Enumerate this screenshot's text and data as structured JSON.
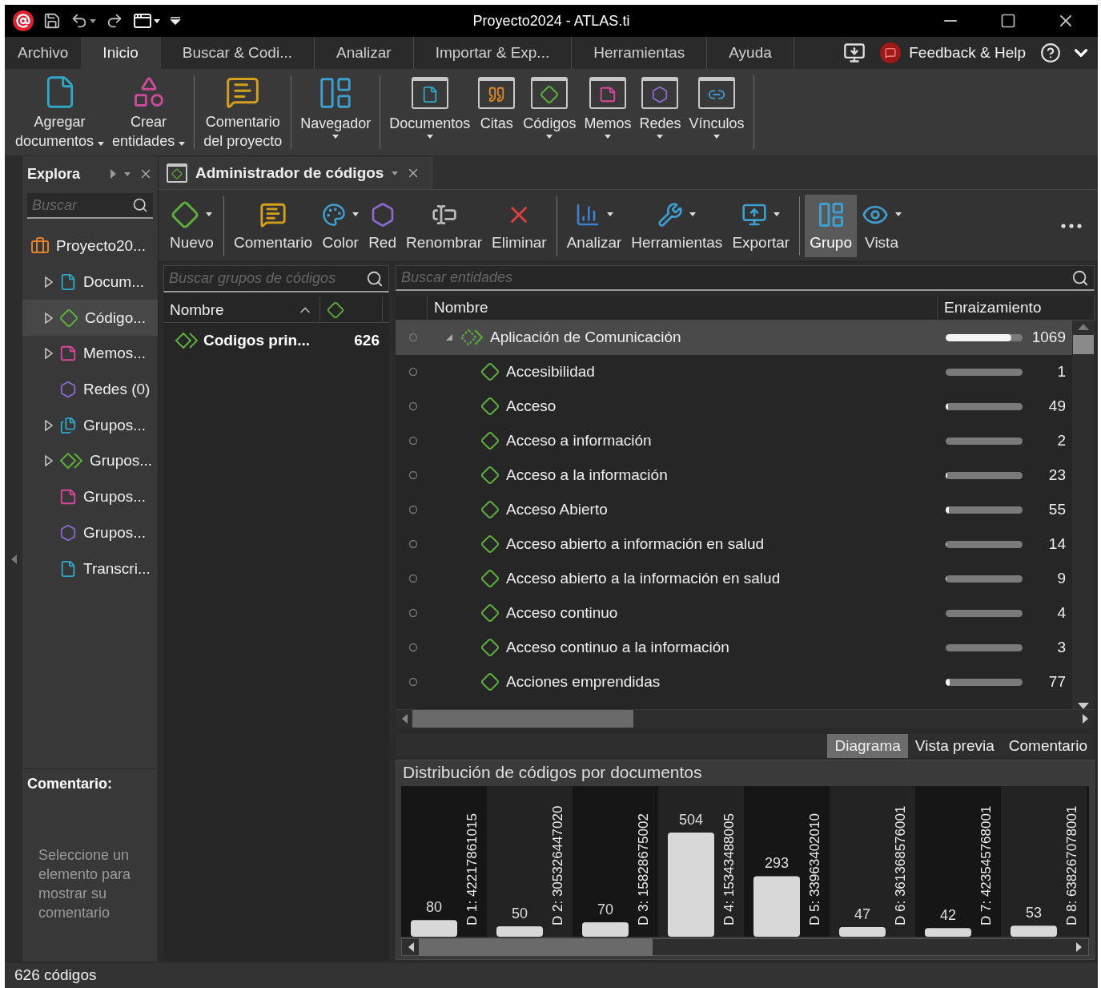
{
  "window": {
    "title": "Proyecto2024 - ATLAS.ti"
  },
  "menu_tabs": [
    {
      "label": "Archivo",
      "selected": false
    },
    {
      "label": "Inicio",
      "selected": true
    },
    {
      "label": "Buscar & Codi...",
      "selected": false
    },
    {
      "label": "Analizar",
      "selected": false
    },
    {
      "label": "Importar & Exp...",
      "selected": false
    },
    {
      "label": "Herramientas",
      "selected": false
    },
    {
      "label": "Ayuda",
      "selected": false
    }
  ],
  "feedback": {
    "label": "Feedback & Help"
  },
  "ribbon": [
    {
      "kind": "add-document",
      "label": "Agregar\ndocumentos",
      "dropdown": true,
      "separator_after": false
    },
    {
      "kind": "create",
      "label": "Crear\nentidades",
      "dropdown": true,
      "separator_after": true
    },
    {
      "kind": "comment",
      "label": "Comentario\ndel proyecto",
      "dropdown": false,
      "separator_after": true
    },
    {
      "kind": "navigator",
      "label": "Navegador",
      "dropdown": true,
      "separator_after": true
    },
    {
      "kind": "documents",
      "label": "Documentos",
      "dropdown": true,
      "separator_after": false
    },
    {
      "kind": "quotes",
      "label": "Citas",
      "dropdown": false,
      "separator_after": false
    },
    {
      "kind": "codes",
      "label": "Códigos",
      "dropdown": true,
      "separator_after": false
    },
    {
      "kind": "memos",
      "label": "Memos",
      "dropdown": true,
      "separator_after": false
    },
    {
      "kind": "networks",
      "label": "Redes",
      "dropdown": true,
      "separator_after": false
    },
    {
      "kind": "links",
      "label": "Vínculos",
      "dropdown": true,
      "separator_after": true
    }
  ],
  "explorer": {
    "title": "Explora",
    "search_placeholder": "Buscar",
    "tree": [
      {
        "kind": "project",
        "label": "Proyecto20...",
        "selected": false,
        "expandable": false,
        "children": [
          {
            "kind": "document",
            "label": "Docum...",
            "selected": false,
            "expandable": true
          },
          {
            "kind": "code",
            "label": "Código...",
            "selected": true,
            "expandable": true
          },
          {
            "kind": "memo",
            "label": "Memos...",
            "selected": false,
            "expandable": true
          },
          {
            "kind": "network",
            "label": "Redes (0)",
            "selected": false,
            "expandable": false
          },
          {
            "kind": "document-group",
            "label": "Grupos...",
            "selected": false,
            "expandable": true
          },
          {
            "kind": "code-group",
            "label": "Grupos...",
            "selected": false,
            "expandable": true
          },
          {
            "kind": "memo-group",
            "label": "Grupos...",
            "selected": false,
            "expandable": false
          },
          {
            "kind": "network-group",
            "label": "Grupos...",
            "selected": false,
            "expandable": false
          },
          {
            "kind": "document",
            "label": "Transcri...",
            "selected": false,
            "expandable": false
          }
        ]
      }
    ]
  },
  "comment_panel": {
    "title": "Comentario:",
    "text": "Seleccione un elemento para mostrar su comentario"
  },
  "manager": {
    "tab": "Administrador de códigos",
    "toolbar": [
      {
        "kind": "new",
        "label": "Nuevo",
        "dropdown": true,
        "selected": false,
        "separator_after": true
      },
      {
        "kind": "comment",
        "label": "Comentario",
        "dropdown": false,
        "selected": false,
        "separator_after": false
      },
      {
        "kind": "color",
        "label": "Color",
        "dropdown": true,
        "selected": false,
        "separator_after": false
      },
      {
        "kind": "network",
        "label": "Red",
        "dropdown": false,
        "selected": false,
        "separator_after": false
      },
      {
        "kind": "rename",
        "label": "Renombrar",
        "dropdown": false,
        "selected": false,
        "separator_after": false
      },
      {
        "kind": "delete",
        "label": "Eliminar",
        "dropdown": false,
        "selected": false,
        "separator_after": true
      },
      {
        "kind": "analyze",
        "label": "Analizar",
        "dropdown": true,
        "selected": false,
        "separator_after": false
      },
      {
        "kind": "tools",
        "label": "Herramientas",
        "dropdown": true,
        "selected": false,
        "separator_after": false
      },
      {
        "kind": "export",
        "label": "Exportar",
        "dropdown": true,
        "selected": false,
        "separator_after": true
      },
      {
        "kind": "group",
        "label": "Grupo",
        "dropdown": false,
        "selected": true,
        "separator_after": false
      },
      {
        "kind": "view",
        "label": "Vista",
        "dropdown": true,
        "selected": false,
        "separator_after": false
      },
      {
        "kind": "more"
      }
    ],
    "groups_pane": {
      "search_placeholder": "Buscar grupos de códigos",
      "columns": [
        "Nombre"
      ],
      "rows": [
        {
          "label": "Codigos prin...",
          "count": "626"
        }
      ]
    },
    "codes_pane": {
      "search_placeholder": "Buscar entidades",
      "columns": [
        "Nombre",
        "Enraizamiento"
      ],
      "rows": [
        {
          "kind": "group",
          "name": "Aplicación de Comunicación",
          "count": "1069",
          "level": 0.85,
          "selected": true,
          "expanded": true,
          "children": [
            {
              "kind": "code",
              "name": "Accesibilidad",
              "count": "1",
              "level": 0,
              "selected": false
            },
            {
              "kind": "code",
              "name": "Acceso",
              "count": "49",
              "level": 0.03,
              "selected": false
            },
            {
              "kind": "code",
              "name": "Acceso a información",
              "count": "2",
              "level": 0,
              "selected": false
            },
            {
              "kind": "code",
              "name": "Acceso a la información",
              "count": "23",
              "level": 0.02,
              "selected": false
            },
            {
              "kind": "code",
              "name": "Acceso Abierto",
              "count": "55",
              "level": 0.04,
              "selected": false
            },
            {
              "kind": "code",
              "name": "Acceso abierto a información en salud",
              "count": "14",
              "level": 0.01,
              "selected": false
            },
            {
              "kind": "code",
              "name": "Acceso abierto a la información en salud",
              "count": "9",
              "level": 0.01,
              "selected": false
            },
            {
              "kind": "code",
              "name": "Acceso continuo",
              "count": "4",
              "level": 0,
              "selected": false
            },
            {
              "kind": "code",
              "name": "Acceso continuo a la información",
              "count": "3",
              "level": 0,
              "selected": false
            },
            {
              "kind": "code",
              "name": "Acciones emprendidas",
              "count": "77",
              "level": 0.05,
              "selected": false
            }
          ]
        }
      ]
    },
    "preview_tabs": [
      {
        "label": "Diagrama",
        "selected": true
      },
      {
        "label": "Vista previa",
        "selected": false
      },
      {
        "label": "Comentario",
        "selected": false
      }
    ],
    "chart_data": {
      "type": "bar",
      "title": "Distribución de códigos por documentos",
      "categories": [
        "D 1: 42217861015",
        "D 2: 305326447020",
        "D 3: 15828675002",
        "D 4: 15343488005",
        "D 5: 33963402010",
        "D 6: 361368576001",
        "D 7: 423545768001",
        "D 8: 638267078001"
      ],
      "values": [
        80,
        50,
        70,
        504,
        293,
        47,
        42,
        53
      ],
      "data_labels": true
    }
  },
  "status_bar": {
    "text": "626 códigos"
  }
}
